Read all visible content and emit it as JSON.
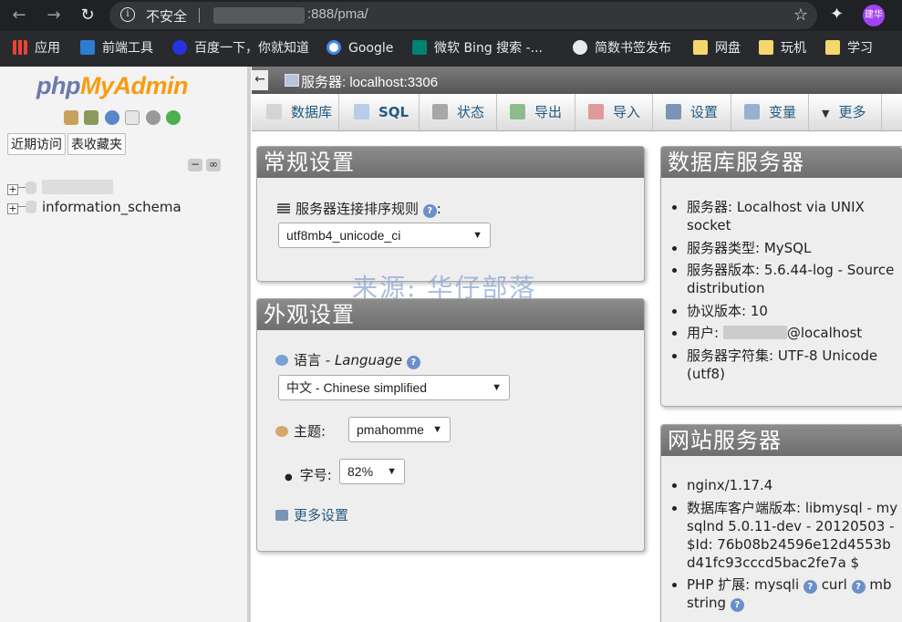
{
  "browser": {
    "insecure_label": "不安全",
    "url_suffix": ":888/pma/",
    "avatar_text": "建华",
    "bookmarks": [
      "应用",
      "前端工具",
      "百度一下，你就知道",
      "Google",
      "微软 Bing 搜索 -...",
      "简数书签发布",
      "网盘",
      "玩机",
      "学习"
    ]
  },
  "sidebar": {
    "logo": {
      "php": "php",
      "my": "My",
      "admin": "Admin"
    },
    "tabs": [
      "近期访问",
      "表收藏夹"
    ],
    "databases": [
      "information_schema"
    ]
  },
  "serverbar": {
    "back": "←",
    "title": "服务器: localhost:3306"
  },
  "topmenu": [
    "数据库",
    "SQL",
    "状态",
    "导出",
    "导入",
    "设置",
    "变量",
    "更多"
  ],
  "general": {
    "title": "常规设置",
    "collation_label": "服务器连接排序规则",
    "collation_colon": ":",
    "collation_value": "utf8mb4_unicode_ci"
  },
  "appearance": {
    "title": "外观设置",
    "language_label": "语言 - ",
    "language_en": "Language",
    "language_value": "中文 - Chinese simplified",
    "theme_label": "主题:",
    "theme_value": "pmahomme",
    "font_label": "字号:",
    "font_value": "82%",
    "more_settings": "更多设置"
  },
  "dbserver": {
    "title": "数据库服务器",
    "items": [
      {
        "k": "服务器:",
        "v": "Localhost via UNIX socket"
      },
      {
        "k": "服务器类型:",
        "v": "MySQL"
      },
      {
        "k": "服务器版本:",
        "v": "5.6.44-log - Source distribution"
      },
      {
        "k": "协议版本:",
        "v": "10"
      },
      {
        "k": "用户:",
        "v": "@localhost"
      },
      {
        "k": "服务器字符集:",
        "v": "UTF-8 Unicode (utf8)"
      }
    ]
  },
  "webserver": {
    "title": "网站服务器",
    "items": [
      "nginx/1.17.4",
      "数据库客户端版本: libmysql - mysqlnd 5.0.11-dev - 20120503 - $Id: 76b08b24596e12d4553bd41fc93cccd5bac2fe7a $",
      "PHP 扩展: mysqli",
      "curl",
      "mbstring"
    ]
  },
  "watermark": "来源: 华仔部落",
  "colors": {
    "accent": "#235a81",
    "panel_head": "#7a7a7a",
    "logo_php": "#6c78af",
    "logo_admin": "#f89c0e"
  }
}
